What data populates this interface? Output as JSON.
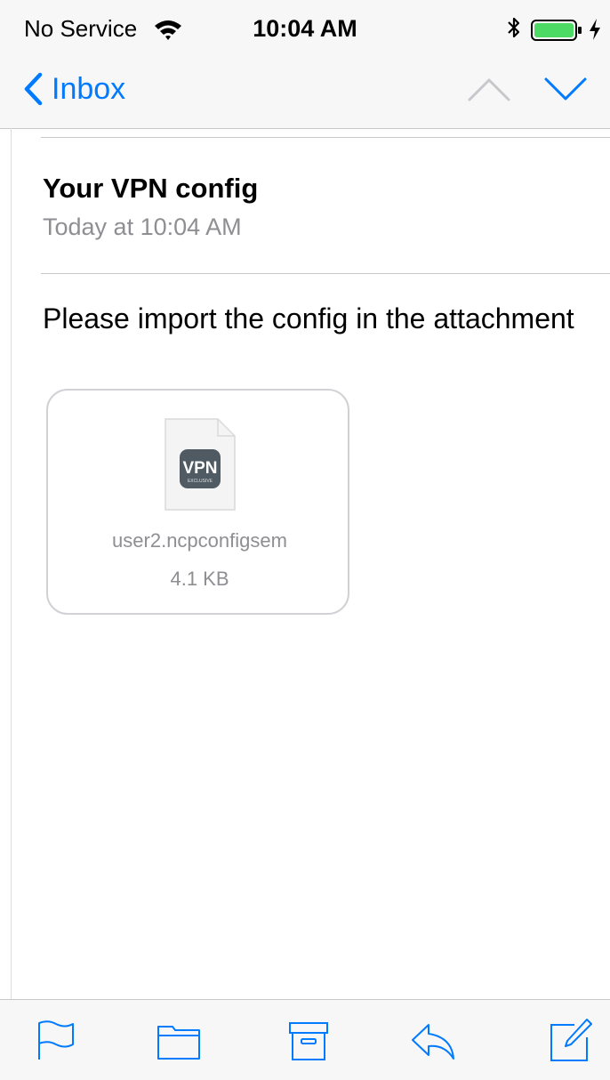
{
  "status_bar": {
    "carrier": "No Service",
    "time": "10:04 AM",
    "icons": [
      "wifi-icon",
      "bluetooth-icon",
      "battery-icon",
      "charging-icon"
    ]
  },
  "nav": {
    "back_label": "Inbox",
    "icons": [
      "chevron-left-icon",
      "chevron-up-icon",
      "chevron-down-icon"
    ]
  },
  "message": {
    "subject": "Your VPN config",
    "date": "Today at 10:04 AM",
    "body": "Please import the config in the attachment"
  },
  "attachment": {
    "icon_label": "VPN",
    "icon_sublabel": "EXCLUSIVE",
    "file_name": "user2.ncpconfigsem",
    "file_size": "4.1 KB"
  },
  "toolbar": {
    "icons": [
      "flag-icon",
      "folder-icon",
      "archive-icon",
      "reply-icon",
      "compose-icon"
    ]
  },
  "colors": {
    "accent": "#007aff",
    "secondary_text": "#8e8e93",
    "battery": "#4cd964",
    "bar_background": "#f7f7f7",
    "divider": "#c8c7cc"
  }
}
